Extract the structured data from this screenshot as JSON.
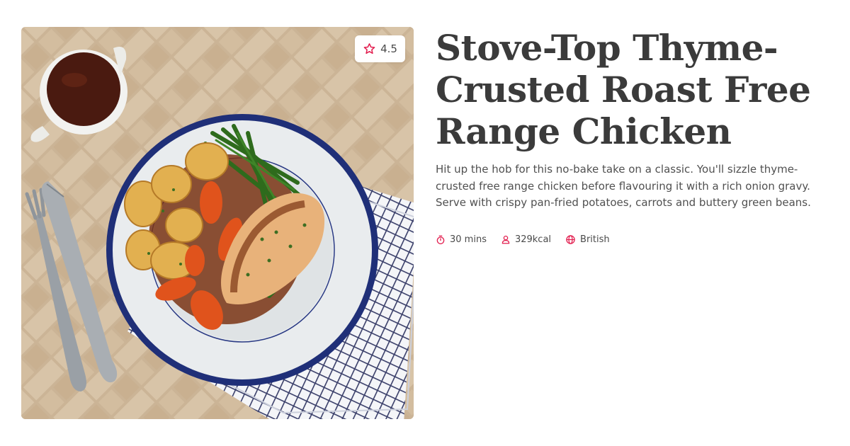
{
  "recipe": {
    "title": "Stove-Top Thyme-Crusted Roast Free Range Chicken",
    "description": "Hit up the hob for this no-bake take on a classic. You'll sizzle thyme-crusted free range chicken before flavouring it with a rich onion gravy. Serve with crispy pan-fried potatoes, carrots and buttery green beans.",
    "rating": "4.5",
    "meta": {
      "time": "30 mins",
      "calories": "329kcal",
      "cuisine": "British"
    }
  },
  "icons": {
    "rating": "star-outline-icon",
    "time": "stopwatch-icon",
    "calories": "person-icon",
    "cuisine": "globe-icon"
  },
  "colors": {
    "accent": "#e21e4f",
    "title": "#3b3b3b",
    "text": "#505050"
  }
}
